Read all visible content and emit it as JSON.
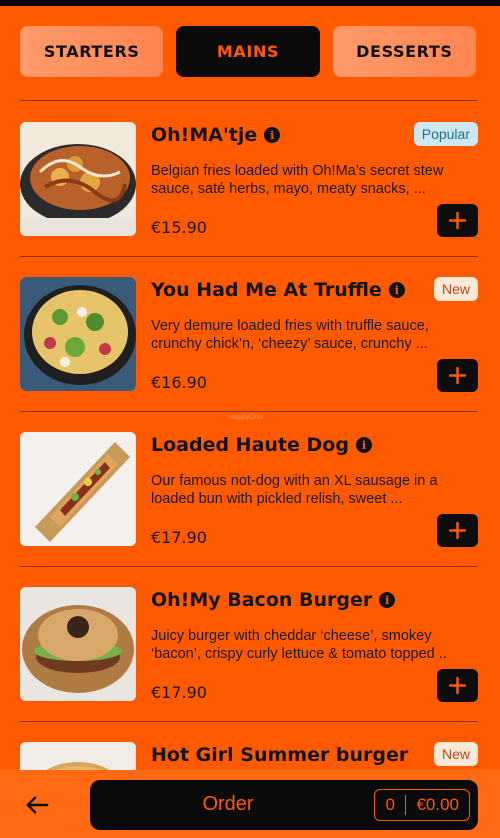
{
  "tabs": [
    {
      "label": "STARTERS"
    },
    {
      "label": "MAINS"
    },
    {
      "label": "DESSERTS"
    }
  ],
  "items": [
    {
      "name": "Oh!MA'tje",
      "badge": "Popular",
      "description": "Belgian fries loaded with Oh!Ma’s secret stew sauce, saté herbs, mayo, meaty snacks, ...",
      "price": "€15.90"
    },
    {
      "name": "You Had Me At Truffle",
      "badge": "New",
      "description": "Very demure loaded fries with truffle sauce, crunchy chick’n, ‘cheezy’ sauce, crunchy ...",
      "price": "€16.90"
    },
    {
      "name": "Loaded Haute Dog",
      "badge": "",
      "description": "Our famous not-dog with an XL sausage in a loaded bun with pickled relish, sweet ...",
      "price": "€17.90"
    },
    {
      "name": "Oh!My Bacon Burger",
      "badge": "",
      "description": "Juicy burger with cheddar ‘cheese’, smokey ‘bacon’, crispy curly lettuce & tomato topped ..",
      "price": "€17.90"
    },
    {
      "name": "Hot Girl Summer burger",
      "badge": "New",
      "description": "",
      "price": ""
    }
  ],
  "info_glyph": "i",
  "order": {
    "label": "Order",
    "count": "0",
    "total": "€0.00"
  },
  "watermark": "HappyCow",
  "colors": {
    "accent": "#ff5a00",
    "dark": "#0a0a0a",
    "popular_bg": "#cfe7f1",
    "new_bg": "#ffe8d6"
  },
  "icons": {
    "info": "info-icon",
    "add": "plus-icon",
    "back": "arrow-left-icon"
  }
}
